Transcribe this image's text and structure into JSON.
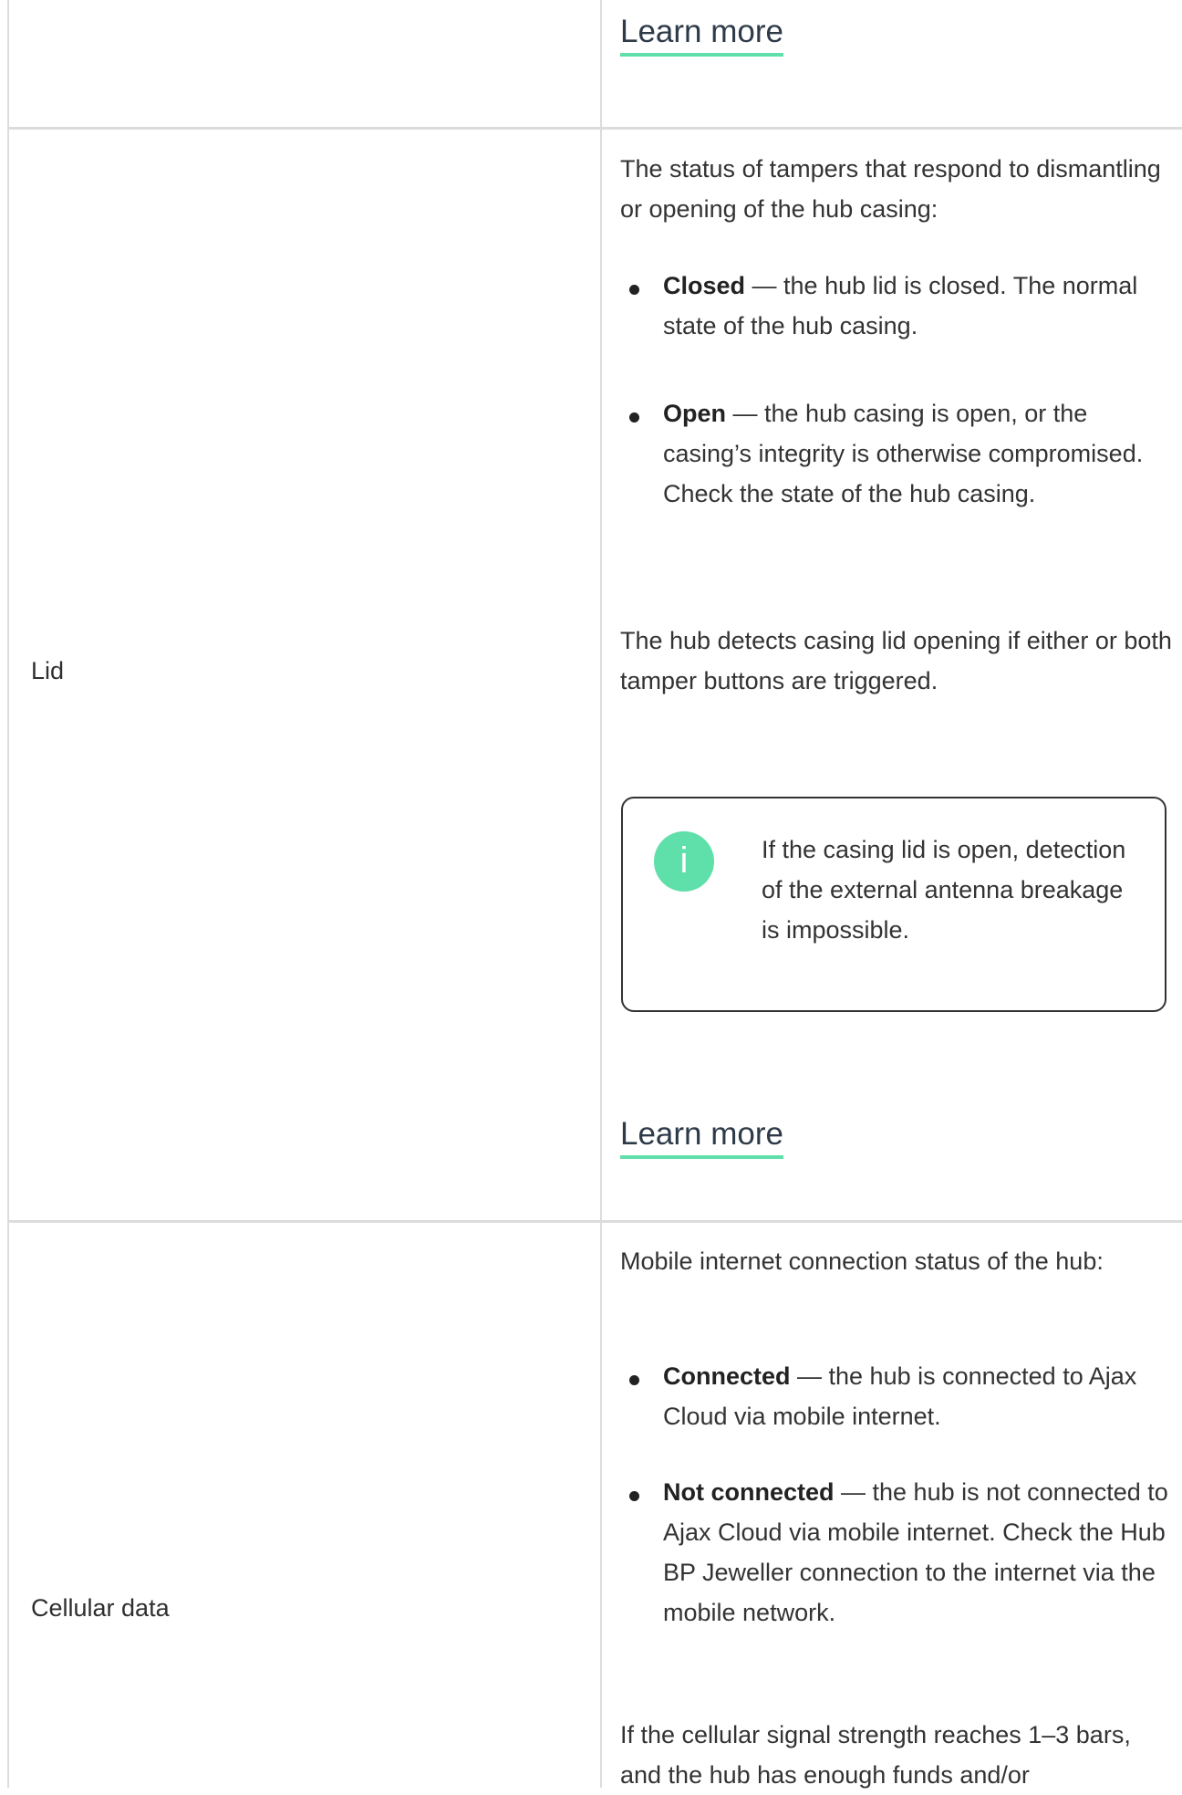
{
  "rows": {
    "top": {
      "learn_more": "Learn more"
    },
    "lid": {
      "label": "Lid",
      "intro": "The status of tampers that respond to dismantling or opening of the hub casing:",
      "items": [
        {
          "term": "Closed",
          "text": " — the hub lid is closed. The normal state of the hub casing."
        },
        {
          "term": "Open",
          "text": " — the hub casing is open, or the casing’s integrity is otherwise compromised. Check the state of the hub casing."
        }
      ],
      "after": "The hub detects casing lid opening if either or both tamper buttons are triggered.",
      "note": {
        "icon": "info-icon",
        "text": "If the casing lid is open, detection of the external antenna breakage is impossible."
      },
      "learn_more": "Learn more"
    },
    "cellular": {
      "label": "Cellular data",
      "intro": "Mobile internet connection status of the hub:",
      "items": [
        {
          "term": "Connected",
          "text": " — the hub is connected to Ajax Cloud via mobile internet."
        },
        {
          "term": "Not connected",
          "text": " — the hub is not connected to Ajax Cloud via mobile internet. Check the Hub BP Jeweller connection to the internet via the mobile network."
        }
      ],
      "after": "If the cellular signal strength reaches 1–3 bars, and the hub has enough funds and/or"
    }
  },
  "colors": {
    "accent": "#5fdfa9",
    "border": "#dcdcdc",
    "text": "#333333"
  }
}
